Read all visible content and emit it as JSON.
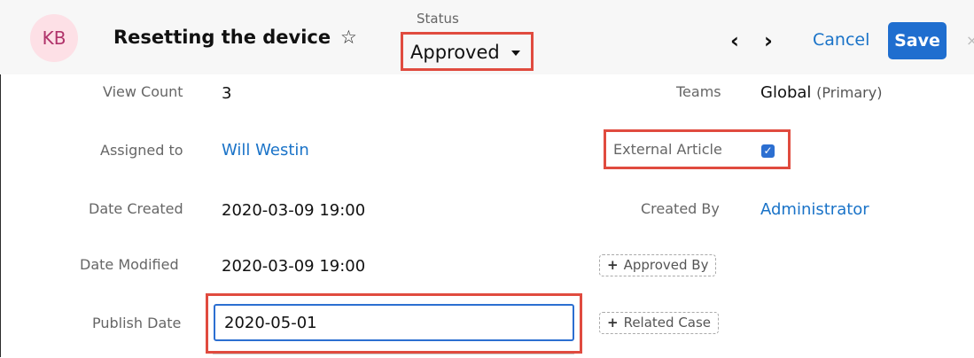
{
  "header": {
    "avatar_initials": "KB",
    "record_title": "Resetting the device",
    "status_label": "Status",
    "status_value": "Approved",
    "cancel_label": "Cancel",
    "save_label": "Save",
    "icons": [
      "star-icon",
      "chevron-left-icon",
      "chevron-right-icon",
      "caret-down-icon"
    ]
  },
  "left_fields": [
    {
      "label": "View Count",
      "value": "3"
    },
    {
      "label": "Assigned to",
      "value": "Will Westin"
    },
    {
      "label": "Date Created",
      "value": "2020-03-09 19:00"
    },
    {
      "label": "Date Modified",
      "value": "2020-03-09 19:00"
    },
    {
      "label": "Publish Date",
      "value": "2020-05-01"
    }
  ],
  "right_fields": {
    "teams_label": "Teams",
    "teams_value": "Global",
    "teams_primary": "(Primary)",
    "external_label": "External Article",
    "external_checked": true,
    "created_by_label": "Created By",
    "created_by_value": "Administrator",
    "approved_by_button": "Approved By",
    "related_case_button": "Related Case"
  },
  "colors": {
    "accent_blue": "#1f6ecf",
    "highlight_red": "#e04b3f",
    "avatar_bg": "#fde0e6"
  }
}
